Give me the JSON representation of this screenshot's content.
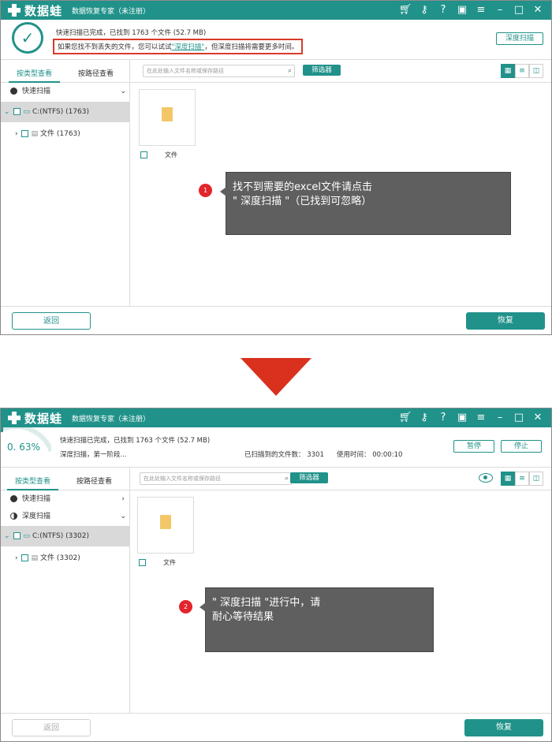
{
  "app": {
    "logo_text": "数据蛙",
    "window_title": "数据恢复专家（未注册）",
    "brand_color": "#21928a",
    "titlebar_icons": [
      "cart-icon",
      "key-icon",
      "help-icon",
      "save-icon",
      "menu-icon",
      "minimize-icon",
      "maximize-icon",
      "close-icon"
    ]
  },
  "top": {
    "status_line1": "快速扫描已完成，已找到 1763 个文件 (52.7 MB)",
    "status_line2_prefix": "如果您找不到丢失的文件，您可以试试",
    "status_line2_link": "\"深度扫描\"",
    "status_line2_suffix": "，但深度扫描将需要更多时间。",
    "deep_scan_button": "深度扫描",
    "tabs": [
      "按类型查看",
      "按路径查看"
    ],
    "tree": {
      "quick_scan": "快速扫描",
      "drive": "C:(NTFS) (1763)",
      "files": "文件 (1763)"
    },
    "search_placeholder": "在此处输入文件名称或保存路径",
    "filter_button": "筛选器",
    "file_tile_label": "文件",
    "callout_marker": "1",
    "callout_line1": "找不到需要的excel文件请点击",
    "callout_line2": "\" 深度扫描 \"（已找到可忽略）",
    "back_button": "返回",
    "restore_button": "恢复"
  },
  "bottom": {
    "progress_percent": "0. 63%",
    "progress_value": 0.0063,
    "status_line1": "快速扫描已完成，已找到 1763 个文件 (52.7 MB)",
    "status_line2": "深度扫描，第一阶段...",
    "found_label": "已扫描到的文件数：",
    "found_value": "3301",
    "time_label": "使用时间：",
    "time_value": "00:00:10",
    "pause_button": "暂停",
    "stop_button": "停止",
    "tabs": [
      "按类型查看",
      "按路径查看"
    ],
    "tree": {
      "quick_scan": "快速扫描",
      "deep_scan": "深度扫描",
      "drive": "C:(NTFS) (3302)",
      "files": "文件 (3302)"
    },
    "search_placeholder": "在此处输入文件名称或保存路径",
    "filter_button": "筛选器",
    "file_tile_label": "文件",
    "callout_marker": "2",
    "callout_line1": "\" 深度扫描 \"进行中，请",
    "callout_line2": "耐心等待结果",
    "back_button": "返回",
    "restore_button": "恢复"
  }
}
